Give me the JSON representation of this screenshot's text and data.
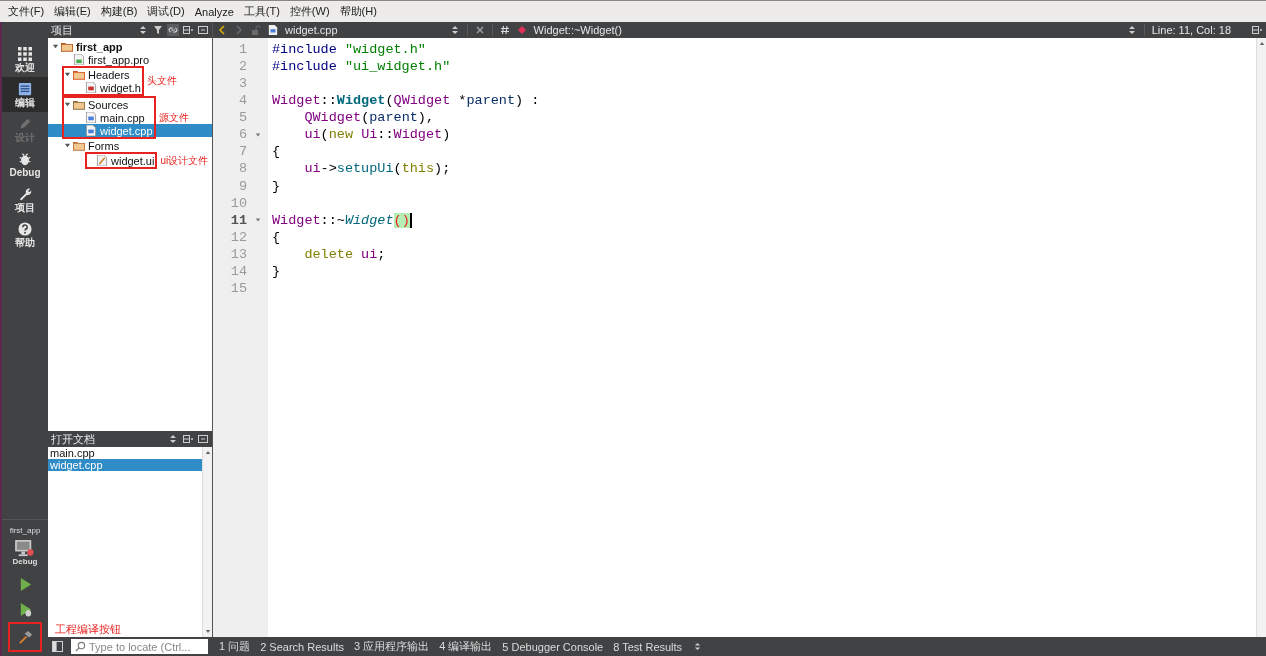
{
  "menu": [
    "文件(F)",
    "编辑(E)",
    "构建(B)",
    "调试(D)",
    "Analyze",
    "工具(T)",
    "控件(W)",
    "帮助(H)"
  ],
  "mode_bar": {
    "modes": [
      {
        "label": "欢迎",
        "kind": "welcome",
        "selected": false,
        "disabled": false
      },
      {
        "label": "编辑",
        "kind": "edit",
        "selected": true,
        "disabled": false
      },
      {
        "label": "设计",
        "kind": "design",
        "selected": false,
        "disabled": true
      },
      {
        "label": "Debug",
        "kind": "debug",
        "selected": false,
        "disabled": false
      },
      {
        "label": "项目",
        "kind": "projects",
        "selected": false,
        "disabled": false
      },
      {
        "label": "帮助",
        "kind": "help",
        "selected": false,
        "disabled": false
      }
    ],
    "project": "first_app",
    "build_config": "Debug",
    "actions": [
      {
        "kind": "run"
      },
      {
        "kind": "debug"
      },
      {
        "kind": "build",
        "note": "工程编译按钮"
      }
    ]
  },
  "projects_pane": {
    "title": "项目",
    "tree": [
      {
        "label": "first_app",
        "kind": "project",
        "expanded": true,
        "selected": false,
        "children": [
          {
            "label": "first_app.pro",
            "kind": "pro",
            "selected": false
          },
          {
            "label": "Headers",
            "kind": "headers",
            "expanded": true,
            "selected": false,
            "annotation": {
              "kind": "group",
              "note": "头文件"
            },
            "children": [
              {
                "label": "widget.h",
                "kind": "header",
                "selected": false
              }
            ]
          },
          {
            "label": "Sources",
            "kind": "sources",
            "expanded": true,
            "selected": false,
            "annotation": {
              "kind": "group",
              "note": "源文件"
            },
            "children": [
              {
                "label": "main.cpp",
                "kind": "source",
                "selected": false
              },
              {
                "label": "widget.cpp",
                "kind": "source",
                "selected": true
              }
            ]
          },
          {
            "label": "Forms",
            "kind": "forms",
            "expanded": true,
            "selected": false,
            "annotation": {
              "kind": "children",
              "note": "ui设计文件"
            },
            "children": [
              {
                "label": "widget.ui",
                "kind": "form",
                "selected": false
              }
            ]
          }
        ]
      }
    ]
  },
  "open_documents": {
    "title": "打开文档",
    "items": [
      {
        "label": "main.cpp",
        "selected": false
      },
      {
        "label": "widget.cpp",
        "selected": true
      }
    ]
  },
  "editor": {
    "file": "widget.cpp",
    "symbol": "Widget::~Widget()",
    "position": "Line: 11, Col: 18",
    "lines": [
      {
        "number": "1",
        "tokens": [
          {
            "text": "#include",
            "kind": "preproc"
          },
          {
            "text": " \"widget.h\"",
            "kind": "string"
          }
        ]
      },
      {
        "number": "2",
        "tokens": [
          {
            "text": "#include",
            "kind": "preproc"
          },
          {
            "text": " \"ui_widget.h\"",
            "kind": "string"
          }
        ]
      },
      {
        "number": "3"
      },
      {
        "number": "4",
        "tokens": [
          {
            "text": "Widget",
            "kind": "type"
          },
          {
            "text": "::",
            "kind": "plain"
          },
          {
            "text": "Widget",
            "kind": "decl"
          },
          {
            "text": "(",
            "kind": "plain"
          },
          {
            "text": "QWidget",
            "kind": "type"
          },
          {
            "text": " *",
            "kind": "plain"
          },
          {
            "text": "parent",
            "kind": "local"
          },
          {
            "text": ") :",
            "kind": "plain"
          }
        ]
      },
      {
        "number": "5",
        "tokens": [
          {
            "text": "    QWidget",
            "kind": "type"
          },
          {
            "text": "(",
            "kind": "plain"
          },
          {
            "text": "parent",
            "kind": "local"
          },
          {
            "text": "),",
            "kind": "plain"
          }
        ]
      },
      {
        "number": "6",
        "foldable": true,
        "tokens": [
          {
            "text": "    ui",
            "kind": "type"
          },
          {
            "text": "(",
            "kind": "plain"
          },
          {
            "text": "new",
            "kind": "keyword"
          },
          {
            "text": " Ui",
            "kind": "type"
          },
          {
            "text": "::",
            "kind": "plain"
          },
          {
            "text": "Widget",
            "kind": "type"
          },
          {
            "text": ")",
            "kind": "plain"
          }
        ]
      },
      {
        "number": "7",
        "tokens": [
          {
            "text": "{",
            "kind": "plain"
          }
        ]
      },
      {
        "number": "8",
        "tokens": [
          {
            "text": "    ui",
            "kind": "type"
          },
          {
            "text": "->",
            "kind": "plain"
          },
          {
            "text": "setupUi",
            "kind": "func"
          },
          {
            "text": "(",
            "kind": "plain"
          },
          {
            "text": "this",
            "kind": "keyword"
          },
          {
            "text": ");",
            "kind": "plain"
          }
        ]
      },
      {
        "number": "9",
        "tokens": [
          {
            "text": "}",
            "kind": "plain"
          }
        ]
      },
      {
        "number": "10"
      },
      {
        "number": "11",
        "foldable": true,
        "current": true,
        "tokens": [
          {
            "text": "Widget",
            "kind": "type"
          },
          {
            "text": "::~",
            "kind": "plain"
          },
          {
            "text": "Widget",
            "kind": "virtual"
          },
          {
            "text": "()",
            "kind": "match"
          }
        ]
      },
      {
        "number": "12",
        "tokens": [
          {
            "text": "{",
            "kind": "plain"
          }
        ]
      },
      {
        "number": "13",
        "tokens": [
          {
            "text": "    delete",
            "kind": "keyword"
          },
          {
            "text": " ui",
            "kind": "type"
          },
          {
            "text": ";",
            "kind": "plain"
          }
        ]
      },
      {
        "number": "14",
        "tokens": [
          {
            "text": "}",
            "kind": "plain"
          }
        ]
      },
      {
        "number": "15"
      }
    ]
  },
  "locator": {
    "placeholder": "Type to locate (Ctrl..."
  },
  "output_tabs": [
    "1 问题",
    "2 Search Results",
    "3 应用程序输出",
    "4 编译输出",
    "5 Debugger Console",
    "8 Test Results"
  ]
}
